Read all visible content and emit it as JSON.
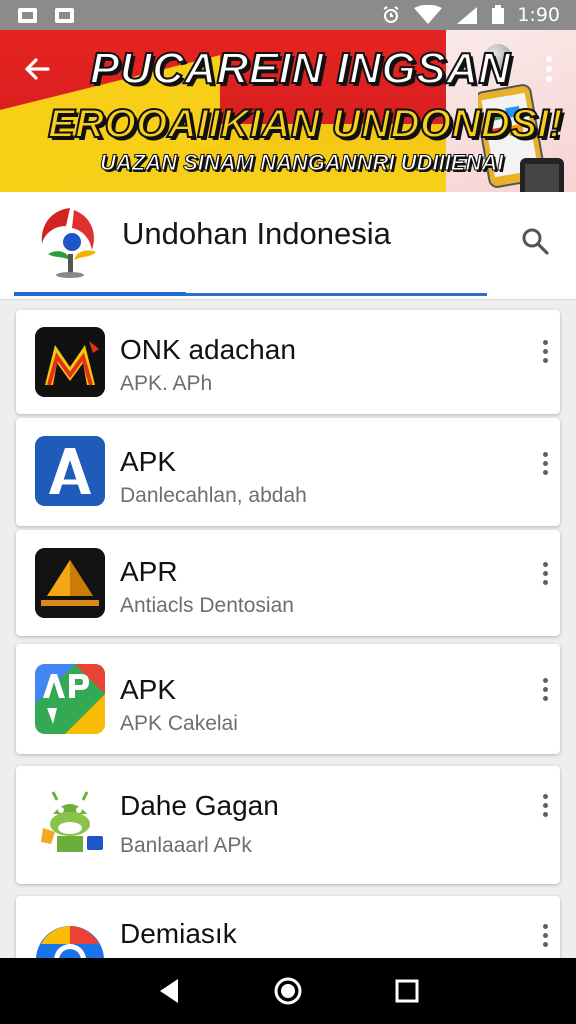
{
  "status_bar": {
    "time": "1:90"
  },
  "banner": {
    "line1": "PUCAREIN INGSAN",
    "line2": "EROOAIIKIAN UNDONDSI!",
    "line3": "UAZAN SINAM NANGANNRI UDIIIENAI"
  },
  "header": {
    "title": "Undohan Indonesia"
  },
  "apps": [
    {
      "name": "ONK adachan",
      "subtitle": "APK. APh"
    },
    {
      "name": "APK",
      "subtitle": "Danlecahlan, abdah"
    },
    {
      "name": "APR",
      "subtitle": "Antiacls Dentosian"
    },
    {
      "name": "APK",
      "subtitle": "APK Cakelai"
    },
    {
      "name": "Dahe Gagan",
      "subtitle": "Banlaaarl APk"
    },
    {
      "name": "Demiasık",
      "subtitle": ""
    }
  ],
  "icons": {
    "back": "arrow-left-icon",
    "overflow": "more-vert-icon",
    "search": "search-icon",
    "nav_back": "triangle-back-icon",
    "nav_home": "circle-home-icon",
    "nav_recents": "square-recents-icon"
  },
  "colors": {
    "banner_red": "#e52421",
    "banner_yellow": "#f6cf16",
    "accent_blue": "#1e6bd6"
  }
}
